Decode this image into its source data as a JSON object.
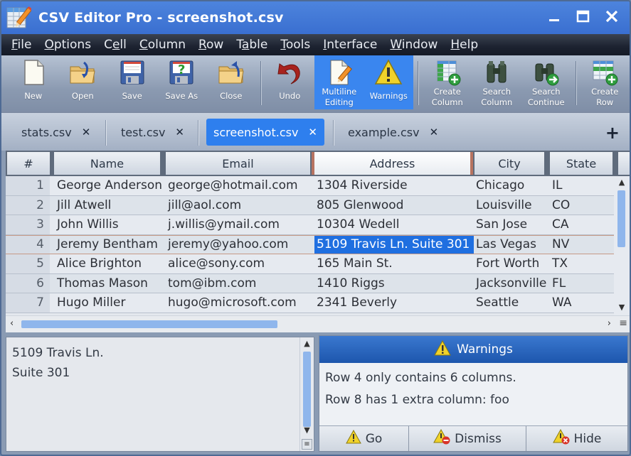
{
  "window": {
    "title": "CSV Editor Pro - screenshot.csv",
    "controls": {
      "minimize": "_",
      "maximize": "□",
      "close": "✕"
    }
  },
  "menu": [
    {
      "label": "File",
      "accel": "F",
      "rest": "ile"
    },
    {
      "label": "Options",
      "accel": "O",
      "rest": "ptions"
    },
    {
      "label": "Cell",
      "pre": "C",
      "accel": "e",
      "rest": "ll"
    },
    {
      "label": "Column",
      "accel": "C",
      "rest": "olumn"
    },
    {
      "label": "Row",
      "accel": "R",
      "rest": "ow"
    },
    {
      "label": "Table",
      "pre": "T",
      "accel": "a",
      "rest": "ble"
    },
    {
      "label": "Tools",
      "accel": "T",
      "rest": "ools"
    },
    {
      "label": "Interface",
      "accel": "I",
      "rest": "nterface"
    },
    {
      "label": "Window",
      "accel": "W",
      "rest": "indow"
    },
    {
      "label": "Help",
      "accel": "H",
      "rest": "elp"
    }
  ],
  "toolbar": {
    "new": "New",
    "open": "Open",
    "save": "Save",
    "save_as": "Save As",
    "close": "Close",
    "undo": "Undo",
    "multiline_1": "Multiline",
    "multiline_2": "Editing",
    "warnings": "Warnings",
    "create_column_1": "Create",
    "create_column_2": "Column",
    "search_column_1": "Search",
    "search_column_2": "Column",
    "search_continue_1": "Search",
    "search_continue_2": "Continue",
    "create_row_1": "Create",
    "create_row_2": "Row"
  },
  "tabs": [
    {
      "label": "stats.csv",
      "close": "✕"
    },
    {
      "label": "test.csv",
      "close": "✕"
    },
    {
      "label": "screenshot.csv",
      "close": "✕",
      "active": true
    },
    {
      "label": "example.csv",
      "close": "✕"
    }
  ],
  "add_tab": "+",
  "grid": {
    "headers": [
      "#",
      "Name",
      "Email",
      "Address",
      "City",
      "State"
    ],
    "selected_column": "Address",
    "rows": [
      [
        "1",
        "George Anderson",
        "george@hotmail.com",
        "1304 Riverside",
        "Chicago",
        "IL"
      ],
      [
        "2",
        "Jill Atwell",
        "jill@aol.com",
        "805 Glenwood",
        "Louisville",
        "CO"
      ],
      [
        "3",
        "John Willis",
        "j.willis@ymail.com",
        "10304 Wedell",
        "San Jose",
        "CA"
      ],
      [
        "4",
        "Jeremy Bentham",
        "jeremy@yahoo.com",
        "5109 Travis Ln. Suite 301",
        "Las Vegas",
        "NV"
      ],
      [
        "5",
        "Alice Brighton",
        "alice@sony.com",
        "165 Main St.",
        "Fort Worth",
        "TX"
      ],
      [
        "6",
        "Thomas Mason",
        "tom@ibm.com",
        "1410 Riggs",
        "Jacksonville",
        "FL"
      ],
      [
        "7",
        "Hugo Miller",
        "hugo@microsoft.com",
        "2341 Beverly",
        "Seattle",
        "WA"
      ]
    ],
    "selected_cell": {
      "row": 4,
      "column": "Address"
    }
  },
  "editor": {
    "lines": [
      "5109 Travis Ln.",
      "Suite 301"
    ]
  },
  "warnings_panel": {
    "title": "Warnings",
    "messages": [
      "Row 4 only contains 6 columns.",
      "Row 8 has 1 extra column: foo"
    ],
    "buttons": {
      "go": "Go",
      "dismiss": "Dismiss",
      "hide": "Hide"
    }
  },
  "colors": {
    "title_bar": "#3f78d6",
    "accent_active": "#2e7fee",
    "selection": "#1f6fe0",
    "warn_header": "#1d56ad"
  }
}
